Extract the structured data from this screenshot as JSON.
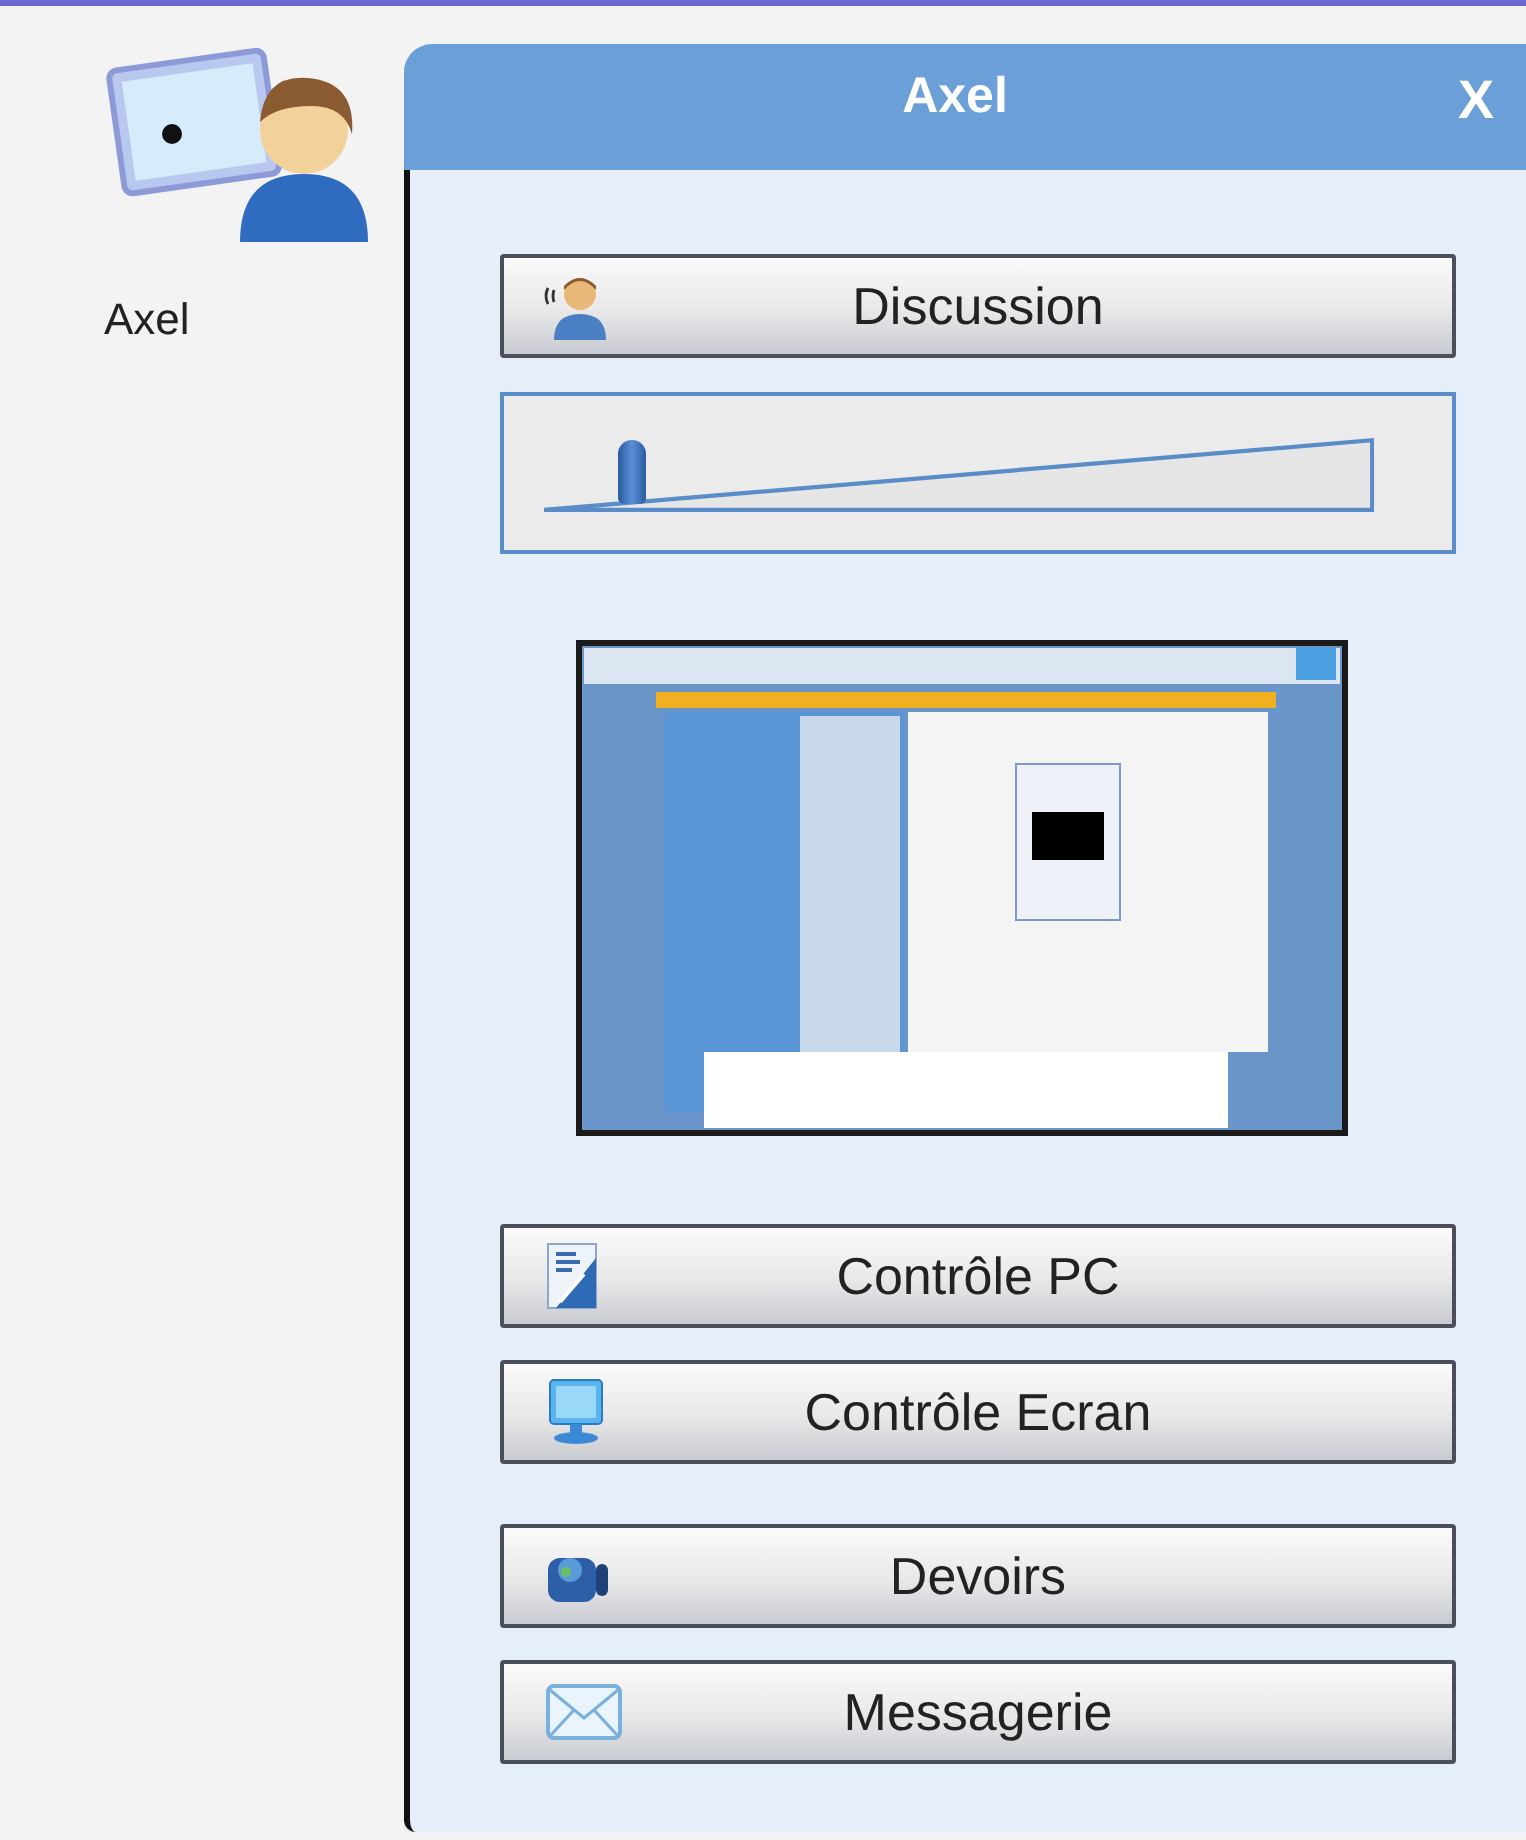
{
  "user": {
    "label": "Axel"
  },
  "panel": {
    "title": "Axel",
    "close": "X"
  },
  "talk_button": {
    "label": "Discussion"
  },
  "volume": {
    "level": 0.09
  },
  "action_groups": [
    [
      {
        "label": "Contrôle PC"
      },
      {
        "label": "Contrôle Ecran"
      }
    ],
    [
      {
        "label": "Devoirs"
      },
      {
        "label": "Messagerie"
      }
    ]
  ]
}
